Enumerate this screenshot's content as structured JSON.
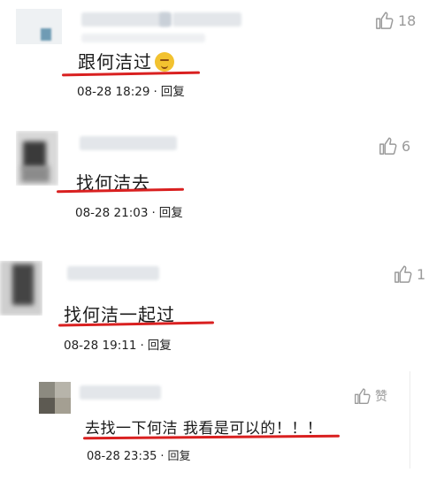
{
  "comments": [
    {
      "text": "跟何洁过",
      "date": "08-28 18:29",
      "sep": "·",
      "reply": "回复",
      "likes": "18",
      "emoji": "thinking-emoji"
    },
    {
      "text": "找何洁去",
      "date": "08-28 21:03",
      "sep": "·",
      "reply": "回复",
      "likes": "6"
    },
    {
      "text": "找何洁一起过",
      "date": "08-28 19:11",
      "sep": "·",
      "reply": "回复",
      "likes": "1"
    }
  ],
  "reply": {
    "text": "去找一下何洁  我看是可以的！！！",
    "date": "08-28 23:35",
    "sep": "·",
    "reply": "回复",
    "like_label": "赞"
  },
  "colors": {
    "underline": "#d92020",
    "icon": "#9a9a9a"
  },
  "icons": {
    "like": "thumbs-up-icon"
  }
}
